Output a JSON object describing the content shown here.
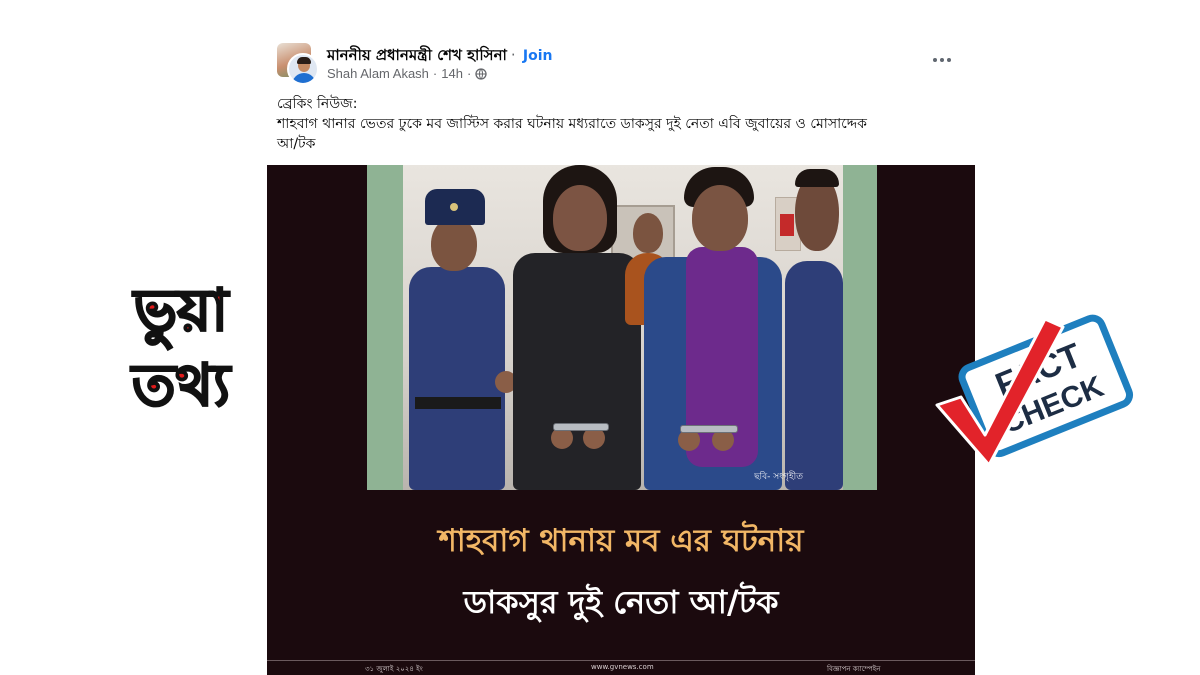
{
  "post": {
    "group_name": "মাননীয় প্রধানমন্ত্রী শেখ হাসিনা",
    "separator": "·",
    "join_label": "Join",
    "author": "Shah Alam Akash",
    "time": "14h",
    "more_icon": "more-horizontal-icon",
    "privacy_icon": "globe-icon",
    "text_line1": "ব্রেকিং নিউজ:",
    "text_line2": "শাহবাগ থানার ভেতর ঢুকে মব জাস্টিস করার ঘটনায় মধ্যরাতে ডাকসুর দুই নেতা এবি জুবায়ের ও মোসাদ্দেক",
    "text_line3": "আ/টক"
  },
  "image": {
    "photo_credit": "ছবি- সংগৃহীত",
    "headline_line1": "শাহবাগ থানায় মব এর ঘটনায়",
    "headline_line2": "ডাকসুর দুই নেতা আ/টক",
    "footer_left": "৩১ জুলাই ২০২৪ ইং",
    "footer_center": "www.gvnews.com",
    "footer_right": "বিজ্ঞাপন ক্যাম্পেইন",
    "colors": {
      "background": "#1b0a0e",
      "headline_accent": "#f2b766",
      "headline_main": "#ffffff"
    }
  },
  "overlay": {
    "fake_word1": "ভুয়া",
    "fake_word2": "তথ্য",
    "fake_color": "#e21b1b",
    "badge_line1": "FACT",
    "badge_line2": "CHECK",
    "badge_colors": {
      "border": "#1e7fbf",
      "check": "#e2232a",
      "text": "#1d2d44"
    }
  },
  "colors": {
    "link": "#1877f2",
    "meta": "#65676b",
    "text": "#050505"
  }
}
